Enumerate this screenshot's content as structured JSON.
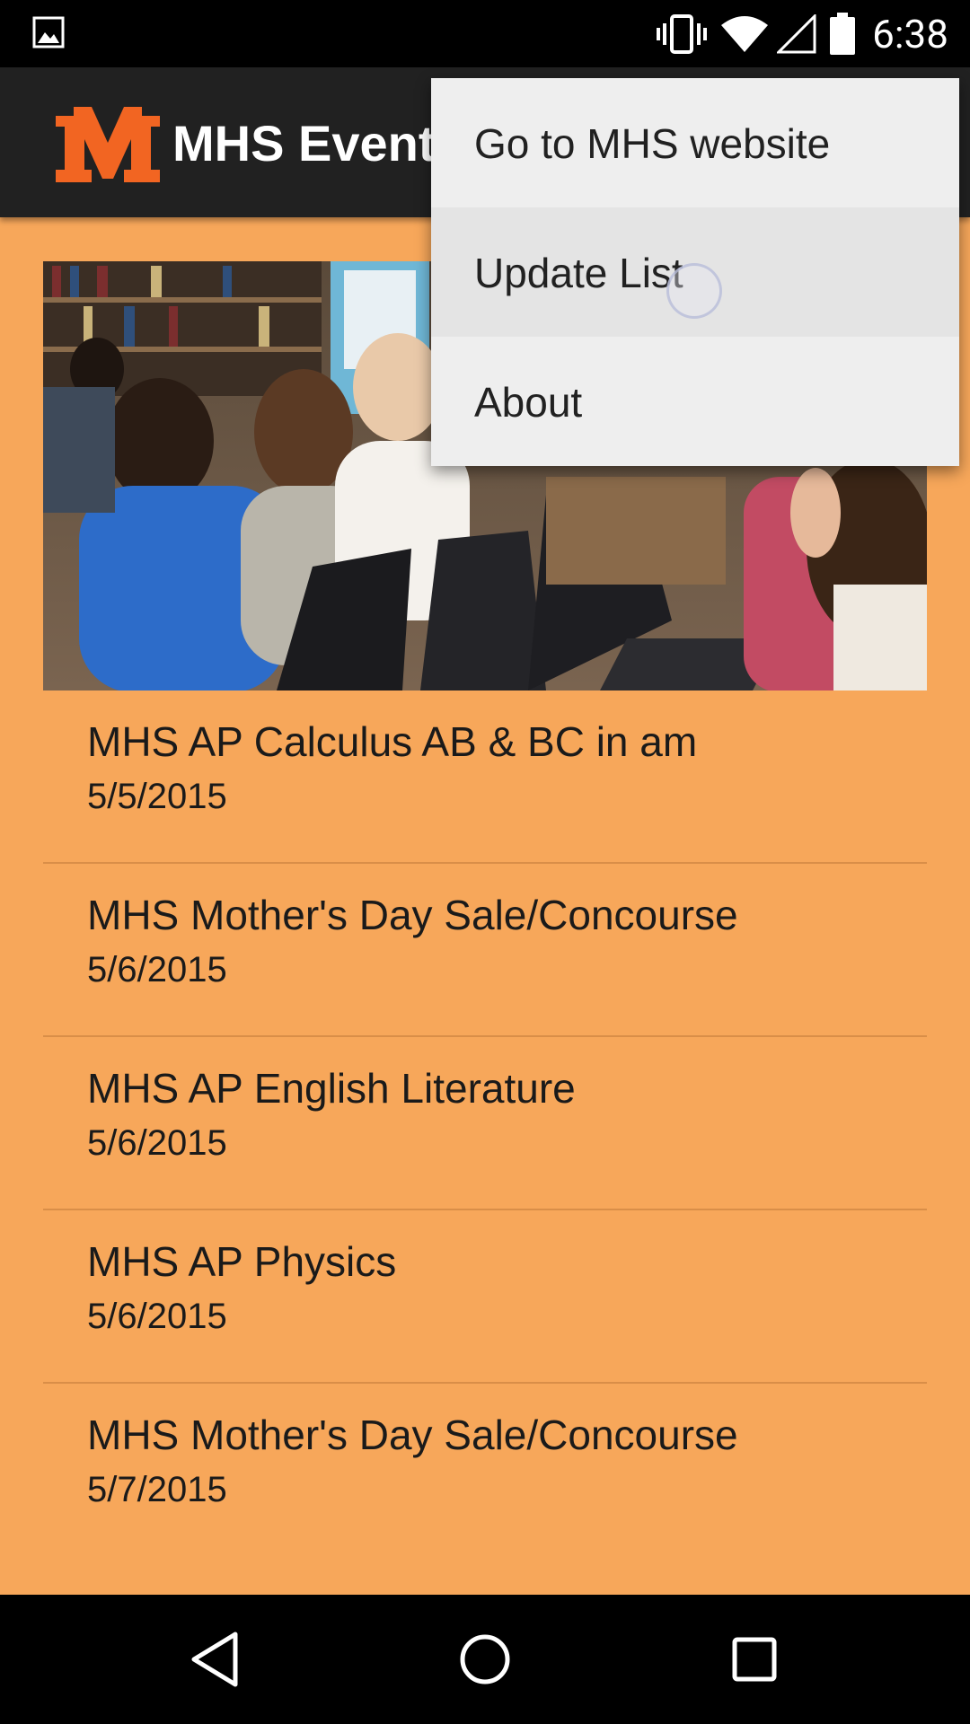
{
  "status_bar": {
    "time": "6:38",
    "icons": [
      "image-notification-icon",
      "vibrate-icon",
      "wifi-icon",
      "cell-signal-icon",
      "battery-icon"
    ]
  },
  "app_bar": {
    "logo_icon": "mhs-m-logo-icon",
    "title": "MHS Events"
  },
  "hero_image": {
    "icon": "students-with-laptops-photo"
  },
  "events": [
    {
      "title": "MHS AP Calculus AB & BC in am",
      "date": "5/5/2015"
    },
    {
      "title": "MHS Mother's Day Sale/Concourse",
      "date": "5/6/2015"
    },
    {
      "title": "MHS AP English Literature",
      "date": "5/6/2015"
    },
    {
      "title": "MHS AP Physics",
      "date": "5/6/2015"
    },
    {
      "title": "MHS Mother's Day Sale/Concourse",
      "date": "5/7/2015"
    }
  ],
  "overflow_menu": {
    "items": [
      {
        "label": "Go to MHS website"
      },
      {
        "label": "Update List"
      },
      {
        "label": "About"
      }
    ]
  },
  "nav_bar": {
    "back_icon": "back-triangle-icon",
    "home_icon": "home-circle-icon",
    "recents_icon": "recents-square-icon"
  },
  "colors": {
    "content_background": "#F7A75A",
    "app_bar_background": "#212121",
    "logo_orange": "#F26522",
    "menu_background": "#EEEEEE"
  }
}
